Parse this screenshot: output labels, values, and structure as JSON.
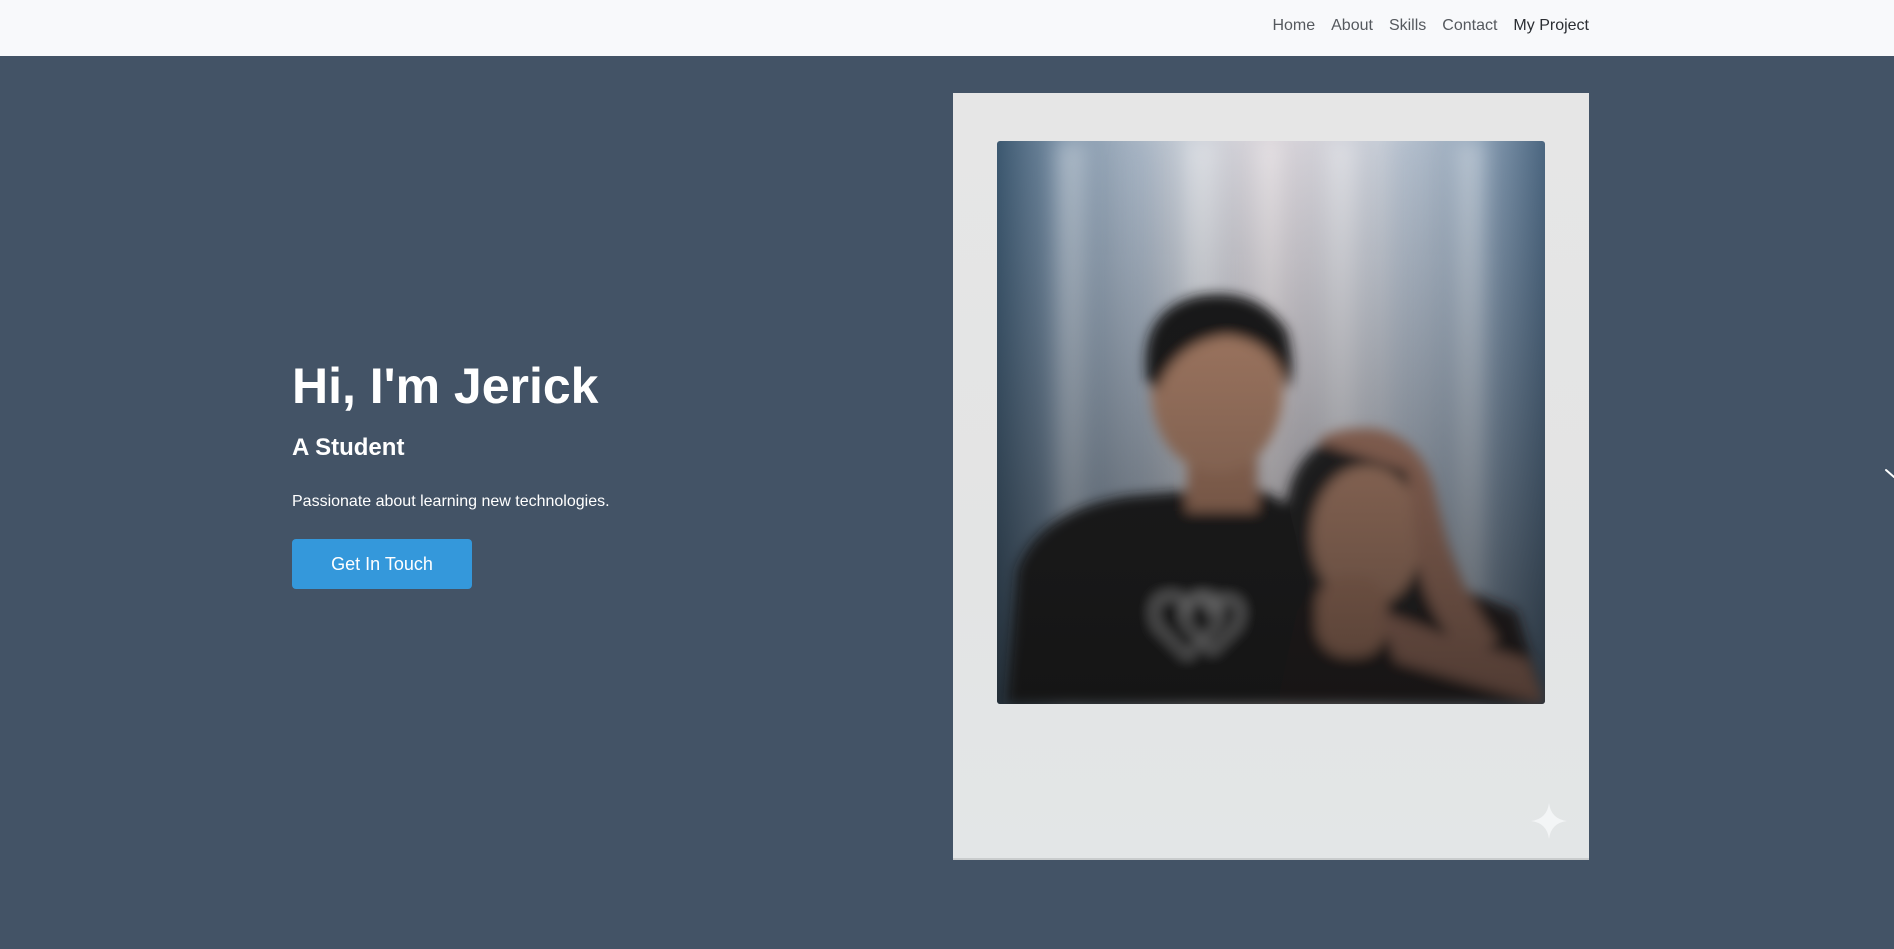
{
  "nav": {
    "items": [
      {
        "label": "Home"
      },
      {
        "label": "About"
      },
      {
        "label": "Skills"
      },
      {
        "label": "Contact"
      },
      {
        "label": "My Project"
      }
    ]
  },
  "hero": {
    "title": "Hi, I'm Jerick",
    "subtitle": "A Student",
    "description": "Passionate about learning new technologies.",
    "cta_label": "Get In Touch"
  },
  "icons": {
    "slider_arrow": "chevron-right-icon",
    "sparkle": "sparkle-icon"
  },
  "colors": {
    "navbar_bg": "#f8f9fb",
    "hero_bg": "#435366",
    "accent": "#3498db",
    "text": "#ffffff"
  }
}
